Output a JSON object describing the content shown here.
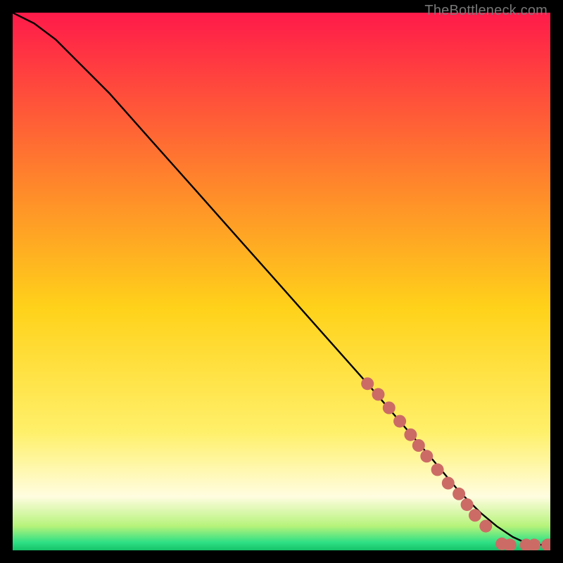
{
  "watermark": "TheBottleneck.com",
  "chart_data": {
    "type": "line",
    "title": "",
    "xlabel": "",
    "ylabel": "",
    "xlim": [
      0,
      100
    ],
    "ylim": [
      0,
      100
    ],
    "grid": false,
    "legend": false,
    "gradient_stops": [
      {
        "offset": 0,
        "color": "#ff1a4a"
      },
      {
        "offset": 0.33,
        "color": "#ff8a2a"
      },
      {
        "offset": 0.55,
        "color": "#ffd21a"
      },
      {
        "offset": 0.78,
        "color": "#fff06a"
      },
      {
        "offset": 0.9,
        "color": "#fffde0"
      },
      {
        "offset": 0.955,
        "color": "#b6f37a"
      },
      {
        "offset": 0.985,
        "color": "#2fe085"
      },
      {
        "offset": 1.0,
        "color": "#15c268"
      }
    ],
    "series": [
      {
        "name": "curve",
        "color": "#000000",
        "x": [
          0,
          4,
          8,
          12,
          18,
          26,
          34,
          42,
          50,
          58,
          66,
          72,
          78,
          83,
          87,
          90,
          93,
          95,
          97,
          99,
          100
        ],
        "y": [
          100,
          98,
          95,
          91,
          85,
          76,
          67,
          58,
          49,
          40,
          31,
          24,
          17,
          11,
          7,
          4.5,
          2.5,
          1.6,
          1.1,
          1.0,
          1.0
        ]
      }
    ],
    "scatter": {
      "name": "dots",
      "color": "#cc6b66",
      "radius": 9,
      "points": [
        {
          "x": 66,
          "y": 31
        },
        {
          "x": 68,
          "y": 29
        },
        {
          "x": 70,
          "y": 26.5
        },
        {
          "x": 72,
          "y": 24
        },
        {
          "x": 74,
          "y": 21.5
        },
        {
          "x": 75.5,
          "y": 19.5
        },
        {
          "x": 77,
          "y": 17.5
        },
        {
          "x": 79,
          "y": 15
        },
        {
          "x": 81,
          "y": 12.5
        },
        {
          "x": 83,
          "y": 10.5
        },
        {
          "x": 84.5,
          "y": 8.5
        },
        {
          "x": 86,
          "y": 6.5
        },
        {
          "x": 88,
          "y": 4.5
        },
        {
          "x": 91,
          "y": 1.2
        },
        {
          "x": 92.5,
          "y": 1.0
        },
        {
          "x": 95.5,
          "y": 1.0
        },
        {
          "x": 97,
          "y": 1.0
        },
        {
          "x": 99.5,
          "y": 1.0
        },
        {
          "x": 100,
          "y": 1.0
        }
      ]
    }
  }
}
